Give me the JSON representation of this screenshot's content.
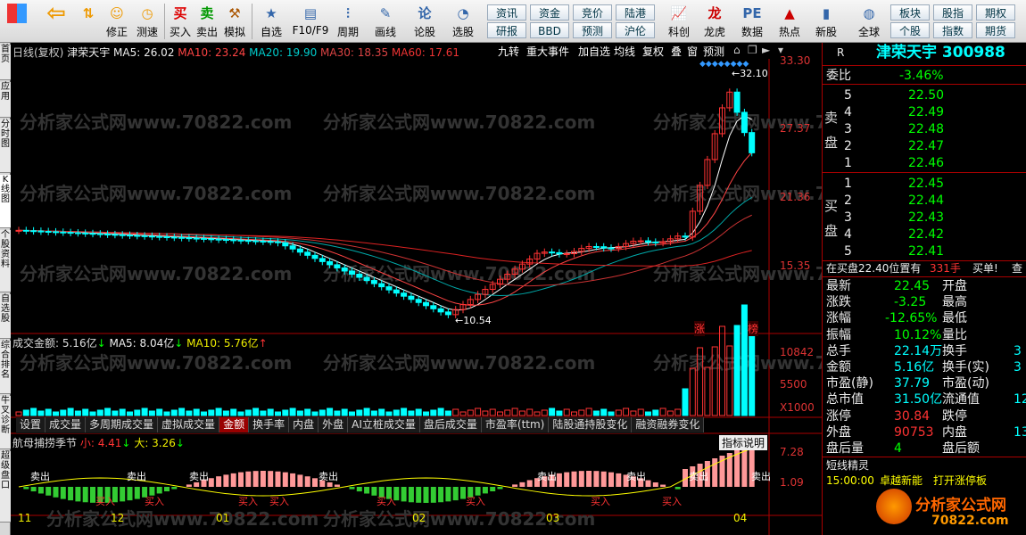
{
  "toolbar": {
    "buttons": [
      "",
      "",
      "修正",
      "测速",
      "买入",
      "卖出",
      "模拟",
      "自选",
      "F10/F9",
      "周期",
      "画线",
      "论股",
      "选股",
      "科创",
      "龙虎",
      "数据",
      "热点",
      "新股",
      "全球"
    ],
    "menu": [
      [
        "资讯",
        "研报"
      ],
      [
        "资金",
        "BBD"
      ],
      [
        "竞价",
        "预测"
      ],
      [
        "陆港",
        "沪伦"
      ],
      [
        "板块",
        "个股"
      ],
      [
        "股指",
        "指数"
      ],
      [
        "期权",
        "期货"
      ]
    ]
  },
  "lefttabs": [
    "首页",
    "应用",
    "分时图",
    "K线图",
    "个股资料",
    "自选股",
    "综合排名",
    "牛叉诊断",
    "超级盘口"
  ],
  "header": {
    "mode": "日线(复权)",
    "name": "津荣天宇",
    "ma5": "MA5: 26.02",
    "ma10": "MA10: 23.24",
    "ma20": "MA20: 19.90",
    "ma30": "MA30: 18.35",
    "ma60": "MA60: 17.61"
  },
  "chart_buttons": [
    "九转",
    "重大事件",
    "加自选",
    "均线",
    "复权",
    "叠",
    "窗",
    "预测"
  ],
  "price_axis": [
    "33.30",
    "27.37",
    "21.36",
    "15.35"
  ],
  "high_label": "32.10",
  "low_label": "10.54",
  "zhang": "涨",
  "bang": "榜",
  "vol": {
    "title": "成交金额: 5.16亿",
    "ma5": "MA5: 8.04亿",
    "ma10": "MA10: 5.76亿",
    "axis": [
      "10842",
      "5500",
      "X1000"
    ]
  },
  "tabs": [
    "设置",
    "成交量",
    "多周期成交量",
    "虚拟成交量",
    "金额",
    "换手率",
    "内盘",
    "外盘",
    "AI立桩成交量",
    "盘后成交量",
    "市盈率(ttm)",
    "陆股通持股变化",
    "融资融券变化"
  ],
  "ind": {
    "title": "航母捕捞季节",
    "small": "小: 4.41",
    "big": "大: 3.26",
    "explain": "指标说明",
    "axis": [
      "7.28",
      "1.09"
    ],
    "buy": "买入",
    "sell": "卖出"
  },
  "xaxis": [
    "11",
    "12",
    "01",
    "02",
    "03",
    "04"
  ],
  "watermark": "分析家公式网www.70822.com",
  "right": {
    "r": "R",
    "title": "津荣天宇  300988",
    "weibi_label": "委比",
    "weibi": "-3.46%",
    "sell_label": "卖盘",
    "buy_label": "买盘",
    "sells": [
      [
        "5",
        "22.50"
      ],
      [
        "4",
        "22.49"
      ],
      [
        "3",
        "22.48"
      ],
      [
        "2",
        "22.47"
      ],
      [
        "1",
        "22.46"
      ]
    ],
    "buys": [
      [
        "1",
        "22.45"
      ],
      [
        "2",
        "22.44"
      ],
      [
        "3",
        "22.43"
      ],
      [
        "4",
        "22.42"
      ],
      [
        "5",
        "22.41"
      ]
    ],
    "note": "在买盘22.40位置有",
    "note_qty": "331手",
    "note_tail": "买单!",
    "note_cut": "查",
    "stats": [
      [
        "最新",
        "22.45",
        "开盘",
        ""
      ],
      [
        "涨跌",
        "-3.25",
        "最高",
        ""
      ],
      [
        "涨幅",
        "-12.65%",
        "最低",
        ""
      ],
      [
        "振幅",
        "10.12%",
        "量比",
        ""
      ],
      [
        "总手",
        "22.14万",
        "换手",
        "3"
      ],
      [
        "金额",
        "5.16亿",
        "换手(实)",
        "3"
      ],
      [
        "市盈(静)",
        "37.79",
        "市盈(动)",
        ""
      ],
      [
        "总市值",
        "31.50亿",
        "流通值",
        "12"
      ],
      [
        "涨停",
        "30.84",
        "跌停",
        ""
      ],
      [
        "外盘",
        "90753",
        "内盘",
        "13"
      ],
      [
        "盘后量",
        "4",
        "盘后额",
        ""
      ]
    ],
    "sprite": "短线精灵",
    "time": "15:00:00",
    "event": "卓越新能",
    "event2": "打开涨停板",
    "brand": "分析家公式网",
    "url": "70822.com"
  }
}
